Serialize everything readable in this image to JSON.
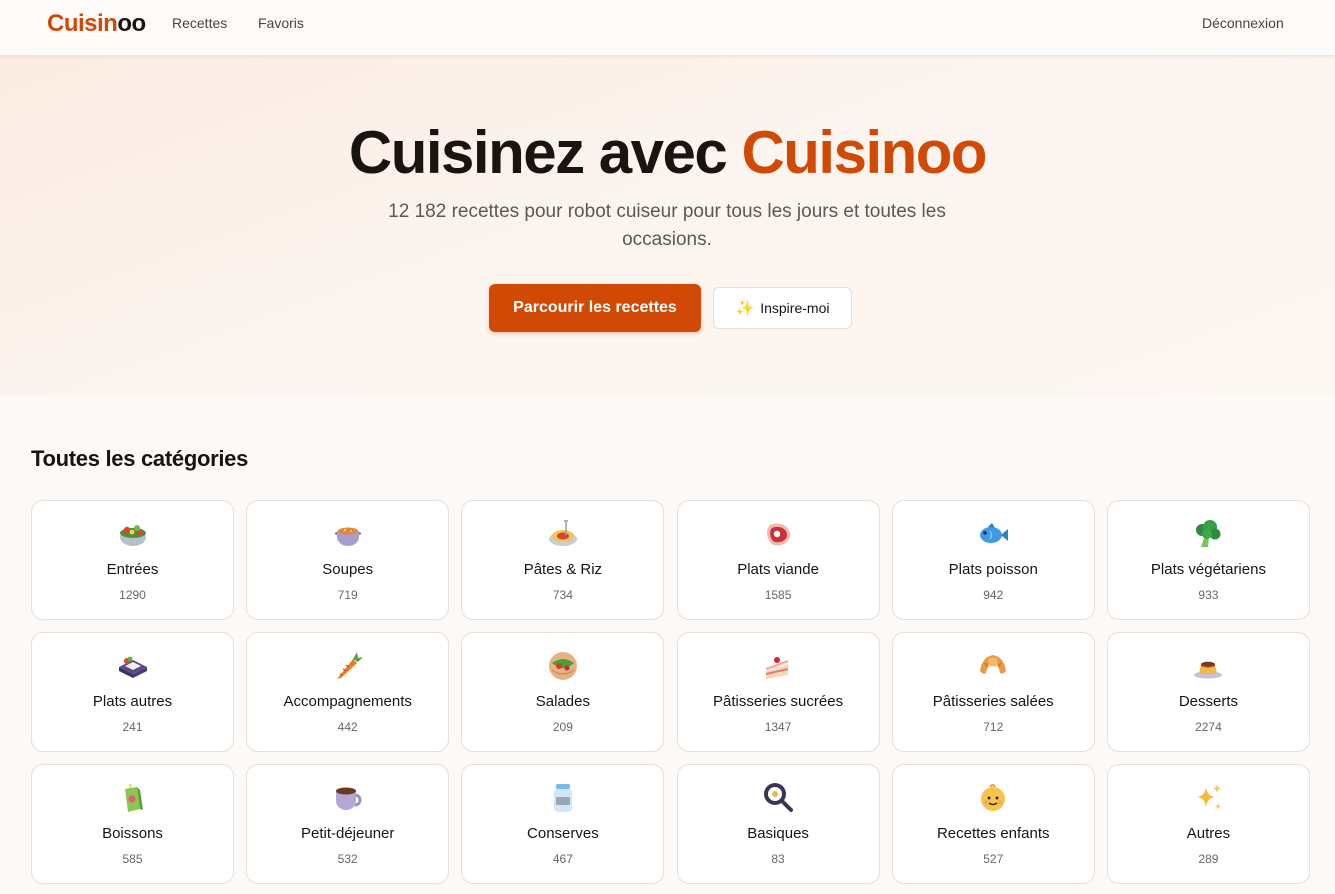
{
  "nav": {
    "logo_part1": "Cuisin",
    "logo_part2": "oo",
    "recettes": "Recettes",
    "favoris": "Favoris",
    "logout": "Déconnexion"
  },
  "hero": {
    "title_part1": "Cuisinez avec ",
    "title_accent": "Cuisinoo",
    "subtitle": "12 182 recettes pour robot cuiseur pour tous les jours et toutes les occasions.",
    "primary_button": "Parcourir les recettes",
    "secondary_button": "Inspire-moi",
    "secondary_icon": "sparkles-icon"
  },
  "colors": {
    "accent": "#d04a06",
    "text": "#1a1410"
  },
  "categories": {
    "title": "Toutes les catégories",
    "items": [
      {
        "label": "Entrées",
        "count": "1290",
        "icon": "salad-bowl-icon"
      },
      {
        "label": "Soupes",
        "count": "719",
        "icon": "soup-pot-icon"
      },
      {
        "label": "Pâtes & Riz",
        "count": "734",
        "icon": "spaghetti-icon"
      },
      {
        "label": "Plats viande",
        "count": "1585",
        "icon": "meat-icon"
      },
      {
        "label": "Plats poisson",
        "count": "942",
        "icon": "fish-icon"
      },
      {
        "label": "Plats végétariens",
        "count": "933",
        "icon": "broccoli-icon"
      },
      {
        "label": "Plats autres",
        "count": "241",
        "icon": "bento-icon"
      },
      {
        "label": "Accompagnements",
        "count": "442",
        "icon": "carrot-icon"
      },
      {
        "label": "Salades",
        "count": "209",
        "icon": "falafel-icon"
      },
      {
        "label": "Pâtisseries sucrées",
        "count": "1347",
        "icon": "cake-slice-icon"
      },
      {
        "label": "Pâtisseries salées",
        "count": "712",
        "icon": "croissant-icon"
      },
      {
        "label": "Desserts",
        "count": "2274",
        "icon": "flan-icon"
      },
      {
        "label": "Boissons",
        "count": "585",
        "icon": "juice-box-icon"
      },
      {
        "label": "Petit-déjeuner",
        "count": "532",
        "icon": "coffee-cup-icon"
      },
      {
        "label": "Conserves",
        "count": "467",
        "icon": "jar-icon"
      },
      {
        "label": "Basiques",
        "count": "83",
        "icon": "frying-pan-icon"
      },
      {
        "label": "Recettes enfants",
        "count": "527",
        "icon": "baby-icon"
      },
      {
        "label": "Autres",
        "count": "289",
        "icon": "sparkles-icon"
      }
    ]
  }
}
